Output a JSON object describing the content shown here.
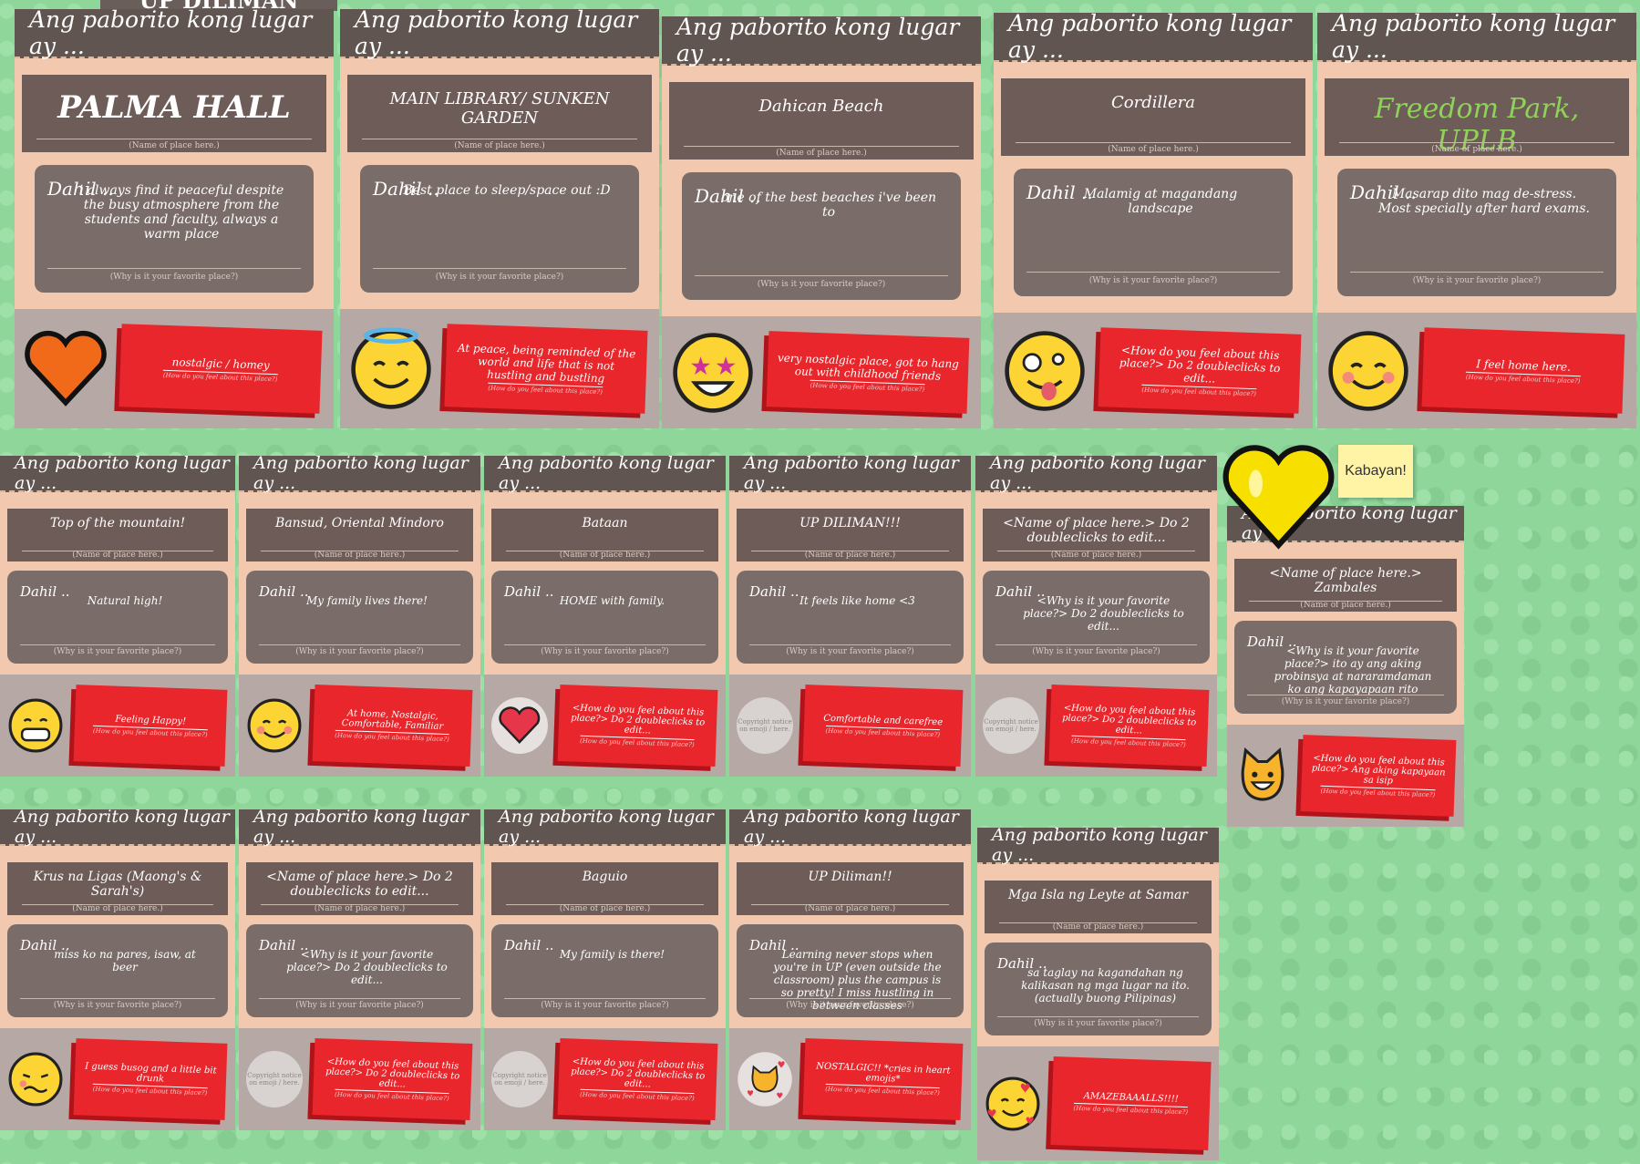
{
  "header_text": "Ang paborito kong lugar ay ...",
  "name_caption": "(Name of place here.)",
  "why_caption": "(Why is it your favorite place?)",
  "feel_caption": "(How do you feel about this place?)",
  "dahil": "Dahil ..",
  "top_clip": "UP DILIMAN",
  "placeholder_image": "Copyright notice on emoji / here.",
  "sticky_note": "Kabayan!",
  "cards": [
    {
      "name": "PALMA HALL",
      "why": "i always find it peaceful despite the busy atmosphere from the students and faculty, always a warm place",
      "feel": "nostalgic / homey",
      "emoji": "orange-heart"
    },
    {
      "name": "MAIN LIBRARY/ SUNKEN GARDEN",
      "why": "Best place to sleep/space out :D",
      "feel": "At peace, being reminded of the world and life that is not hustling and bustling",
      "emoji": "halo-smile"
    },
    {
      "name": "Dahican Beach",
      "why": "one of the best beaches i've been to",
      "feel": "very nostalgic place, got to hang out with childhood friends",
      "emoji": "star-eyes"
    },
    {
      "name": "Cordillera",
      "why": "Malamig at magandang landscape",
      "feel": "<How do you feel about this place?> Do 2 doubleclicks to edit...",
      "emoji": "zany-face"
    },
    {
      "name": "Freedom Park, UPLB",
      "why": "Masarap dito mag de-stress. Most specially after hard exams.",
      "feel": "I feel home here.",
      "emoji": "blush-smile"
    },
    {
      "name": "Top of the mountain!",
      "why": "Natural high!",
      "feel": "Feeling Happy!",
      "emoji": "grin"
    },
    {
      "name": "Bansud, Oriental Mindoro",
      "why": "My family lives there!",
      "feel": "At home, Nostalgic, Comfortable, Familiar",
      "emoji": "blush-smile"
    },
    {
      "name": "Bataan",
      "why": "HOME with family.",
      "feel": "<How do you feel about this place?> Do 2 doubleclicks to edit...",
      "emoji": "red-heart"
    },
    {
      "name": "UP DILIMAN!!!",
      "why": "It feels like home <3",
      "feel": "Comfortable and carefree",
      "emoji": "placeholder"
    },
    {
      "name": "<Name of place here.> Do 2 doubleclicks to edit...",
      "why": "<Why is it your favorite place?> Do 2 doubleclicks to edit...",
      "feel": "<How do you feel about this place?> Do 2 doubleclicks to edit...",
      "emoji": "placeholder"
    },
    {
      "name": "<Name of place here.> Zambales",
      "why": "<Why is it your favorite place?> ito ay ang aking probinsya at nararamdaman ko ang kapayapaan rito",
      "feel": "<How do you feel about this place?> Ang aking kapayaan sa isip",
      "emoji": "cat-face"
    },
    {
      "name": "Krus na Ligas (Maong's & Sarah's)",
      "why": "miss ko na pares, isaw, at beer",
      "feel": "I guess busog and a little bit drunk",
      "emoji": "woozy"
    },
    {
      "name": "<Name of place here.> Do 2 doubleclicks to edit...",
      "why": "<Why is it your favorite place?> Do 2 doubleclicks to edit...",
      "feel": "<How do you feel about this place?> Do 2 doubleclicks to edit...",
      "emoji": "placeholder"
    },
    {
      "name": "Baguio",
      "why": "My family is there!",
      "feel": "<How do you feel about this place?> Do 2 doubleclicks to edit...",
      "emoji": "placeholder"
    },
    {
      "name": "UP Diliman!!",
      "why": "Learning never stops when you're in UP (even outside the classroom) plus the campus is so pretty! I miss hustling in between classes",
      "feel": "NOSTALGIC!! *cries in heart emojis*",
      "emoji": "cat-hearts"
    },
    {
      "name": "Mga Isla ng Leyte at Samar",
      "why": "sa taglay na kagandahan ng kalikasan ng mga lugar na ito. (actually buong Pilipinas)",
      "feel": "AMAZEBAAALLS!!!!",
      "emoji": "hearts-smile"
    }
  ],
  "colors": {
    "background": "#8fd69a",
    "card": "#f2c9ae",
    "header": "#605550",
    "name_box": "#6e5c58",
    "why_box": "#7a6d69",
    "footer": "#b5a8a5",
    "feel_tag": "#e8262b",
    "accent_green": "#8fd25a"
  }
}
